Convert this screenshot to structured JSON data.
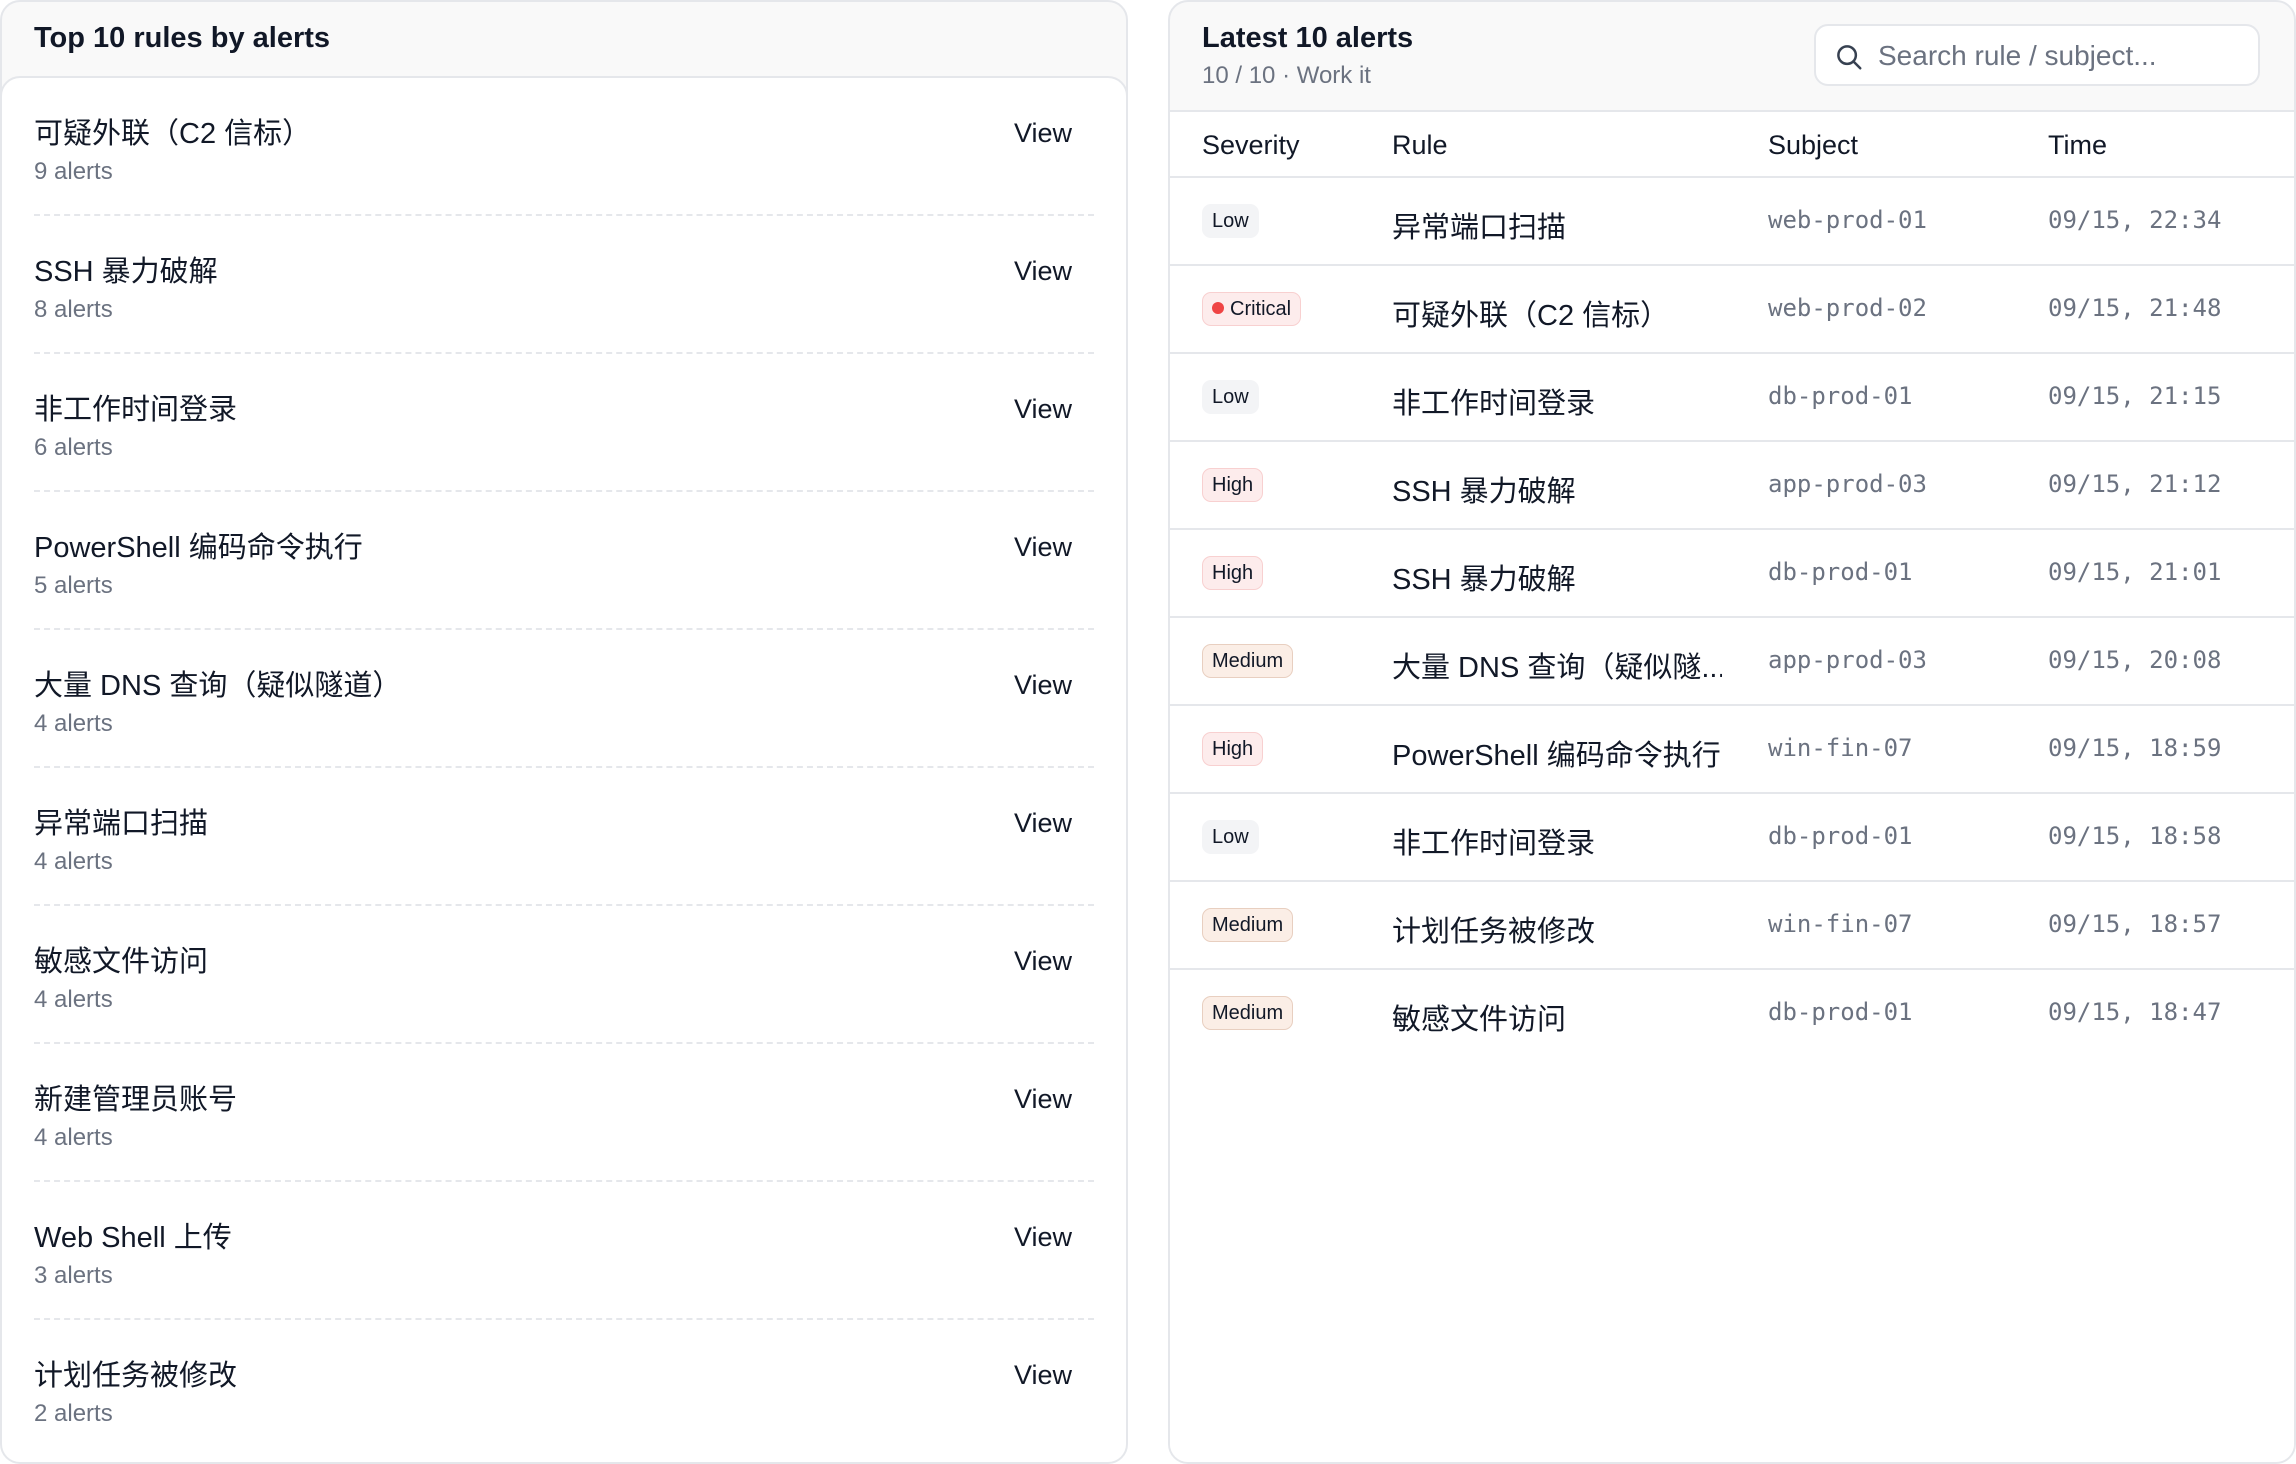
{
  "top_rules": {
    "title": "Top 10 rules by alerts",
    "view_label": "View",
    "items": [
      {
        "name": "可疑外联（C2 信标）",
        "count": "9 alerts"
      },
      {
        "name": "SSH 暴力破解",
        "count": "8 alerts"
      },
      {
        "name": "非工作时间登录",
        "count": "6 alerts"
      },
      {
        "name": "PowerShell 编码命令执行",
        "count": "5 alerts"
      },
      {
        "name": "大量 DNS 查询（疑似隧道）",
        "count": "4 alerts"
      },
      {
        "name": "异常端口扫描",
        "count": "4 alerts"
      },
      {
        "name": "敏感文件访问",
        "count": "4 alerts"
      },
      {
        "name": "新建管理员账号",
        "count": "4 alerts"
      },
      {
        "name": "Web Shell 上传",
        "count": "3 alerts"
      },
      {
        "name": "计划任务被修改",
        "count": "2 alerts"
      }
    ]
  },
  "latest": {
    "title": "Latest 10 alerts",
    "subtitle": "10 / 10 · Work it",
    "search": {
      "placeholder": "Search rule / subject...",
      "value": ""
    },
    "columns": {
      "severity": "Severity",
      "rule": "Rule",
      "subject": "Subject",
      "time": "Time"
    },
    "rows": [
      {
        "severity": "Low",
        "sev_class": "low",
        "rule": "异常端口扫描",
        "subject": "web-prod-01",
        "time": "09/15, 22:34"
      },
      {
        "severity": "Critical",
        "sev_class": "critical",
        "rule": "可疑外联（C2 信标）",
        "subject": "web-prod-02",
        "time": "09/15, 21:48"
      },
      {
        "severity": "Low",
        "sev_class": "low",
        "rule": "非工作时间登录",
        "subject": "db-prod-01",
        "time": "09/15, 21:15"
      },
      {
        "severity": "High",
        "sev_class": "high",
        "rule": "SSH 暴力破解",
        "subject": "app-prod-03",
        "time": "09/15, 21:12"
      },
      {
        "severity": "High",
        "sev_class": "high",
        "rule": "SSH 暴力破解",
        "subject": "db-prod-01",
        "time": "09/15, 21:01"
      },
      {
        "severity": "Medium",
        "sev_class": "medium",
        "rule": "大量 DNS 查询（疑似隧...",
        "subject": "app-prod-03",
        "time": "09/15, 20:08"
      },
      {
        "severity": "High",
        "sev_class": "high",
        "rule": "PowerShell 编码命令执行",
        "subject": "win-fin-07",
        "time": "09/15, 18:59"
      },
      {
        "severity": "Low",
        "sev_class": "low",
        "rule": "非工作时间登录",
        "subject": "db-prod-01",
        "time": "09/15, 18:58"
      },
      {
        "severity": "Medium",
        "sev_class": "medium",
        "rule": "计划任务被修改",
        "subject": "win-fin-07",
        "time": "09/15, 18:57"
      },
      {
        "severity": "Medium",
        "sev_class": "medium",
        "rule": "敏感文件访问",
        "subject": "db-prod-01",
        "time": "09/15, 18:47"
      }
    ]
  }
}
